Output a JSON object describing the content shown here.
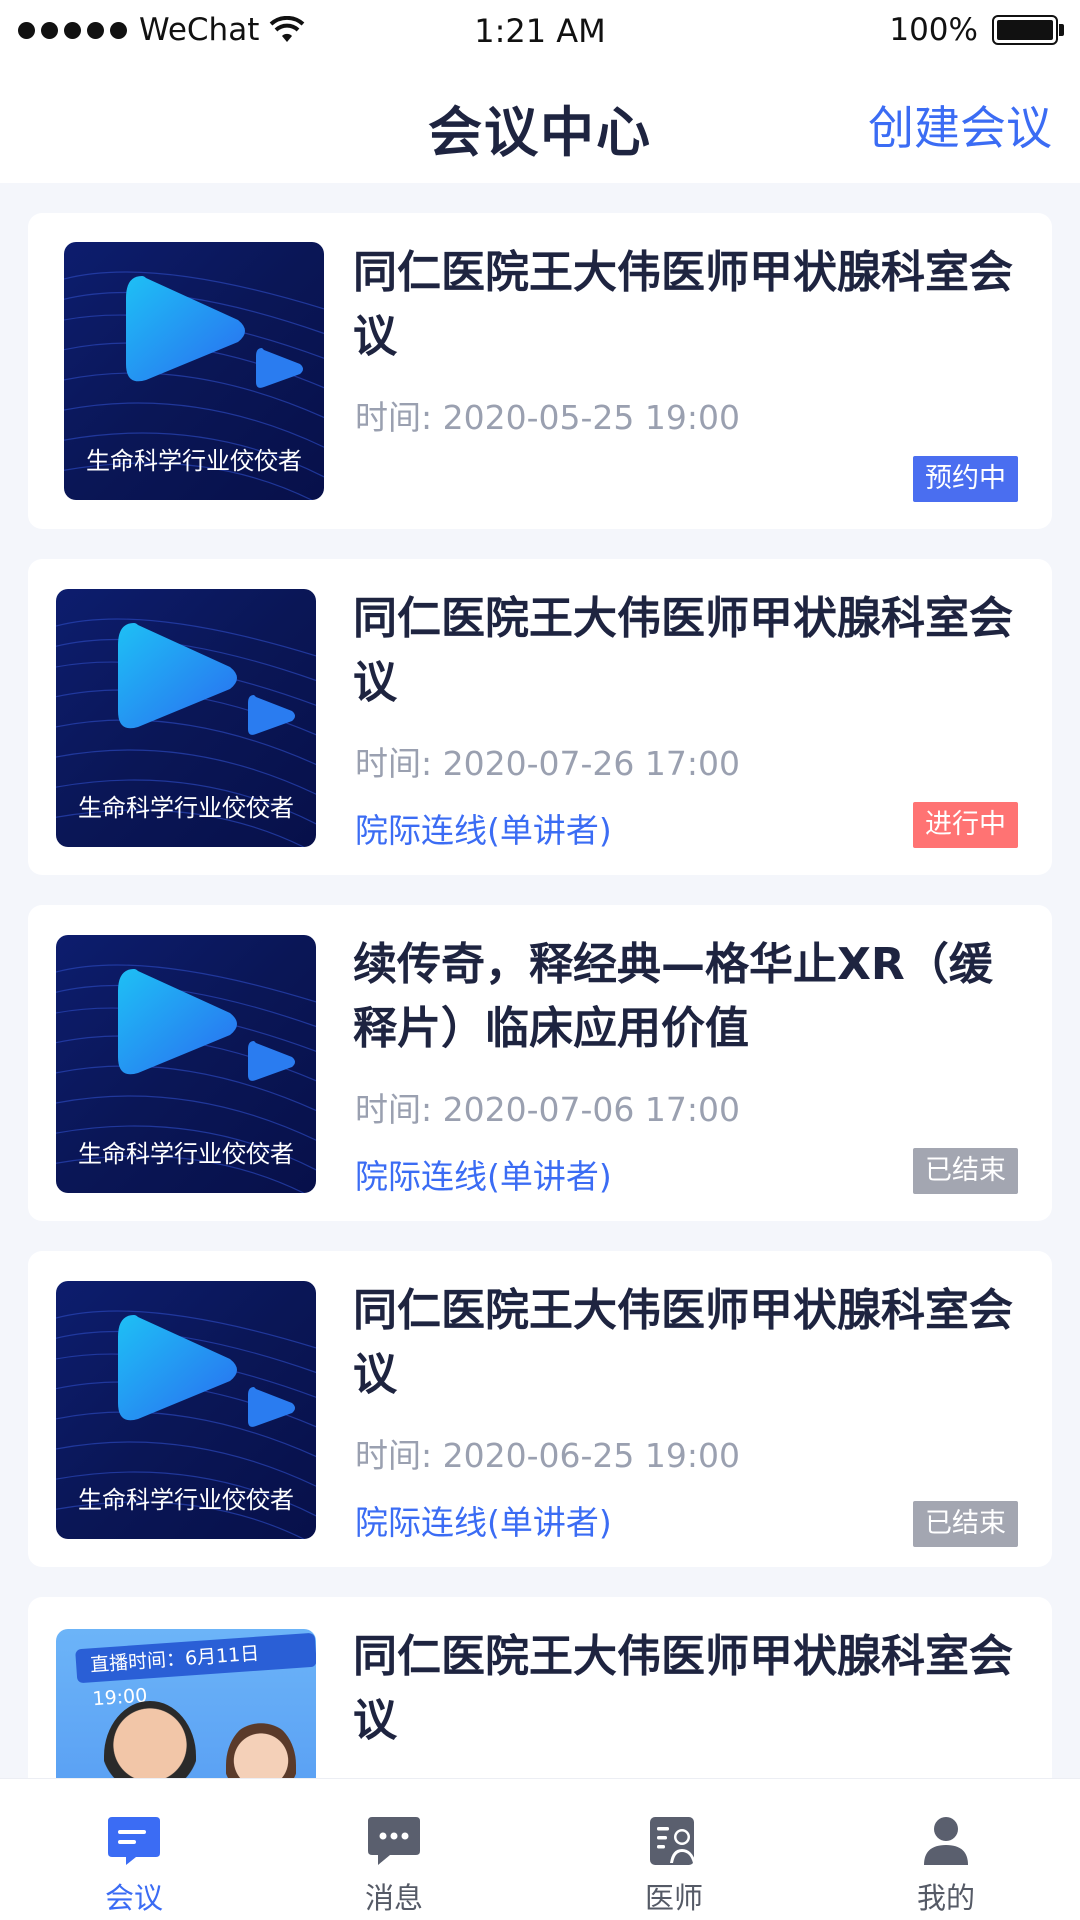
{
  "status_bar": {
    "carrier": "WeChat",
    "time": "1:21 AM",
    "battery": "100%"
  },
  "header": {
    "title": "会议中心",
    "create_label": "创建会议"
  },
  "meetings": [
    {
      "thumb_label": "生命科学行业佼佼者",
      "title": "同仁医院王大伟医师甲状腺科室会议",
      "time": "时间: 2020-05-25 19:00",
      "type": "",
      "status": "预约中",
      "status_color": "#4a6ef0"
    },
    {
      "thumb_label": "生命科学行业佼佼者",
      "title": "同仁医院王大伟医师甲状腺科室会议",
      "time": "时间: 2020-07-26 17:00",
      "type": "院际连线(单讲者)",
      "status": "进行中",
      "status_color": "#ff7373"
    },
    {
      "thumb_label": "生命科学行业佼佼者",
      "title": "续传奇，释经典—格华止XR（缓释片）临床应用价值",
      "time": "时间: 2020-07-06 17:00",
      "type": "院际连线(单讲者)",
      "status": "已结束",
      "status_color": "#a3a6b1"
    },
    {
      "thumb_label": "生命科学行业佼佼者",
      "title": "同仁医院王大伟医师甲状腺科室会议",
      "time": "时间: 2020-06-25 19:00",
      "type": "院际连线(单讲者)",
      "status": "已结束",
      "status_color": "#a3a6b1"
    },
    {
      "thumb_banner": "直播时间：6月11日 19:00",
      "title": "同仁医院王大伟医师甲状腺科室会议"
    }
  ],
  "tabbar": {
    "items": [
      {
        "label": "会议",
        "icon": "meeting-icon",
        "active": true
      },
      {
        "label": "消息",
        "icon": "message-icon",
        "active": false
      },
      {
        "label": "医师",
        "icon": "doctor-icon",
        "active": false
      },
      {
        "label": "我的",
        "icon": "profile-icon",
        "active": false
      }
    ],
    "active_color": "#3b6cf4"
  }
}
